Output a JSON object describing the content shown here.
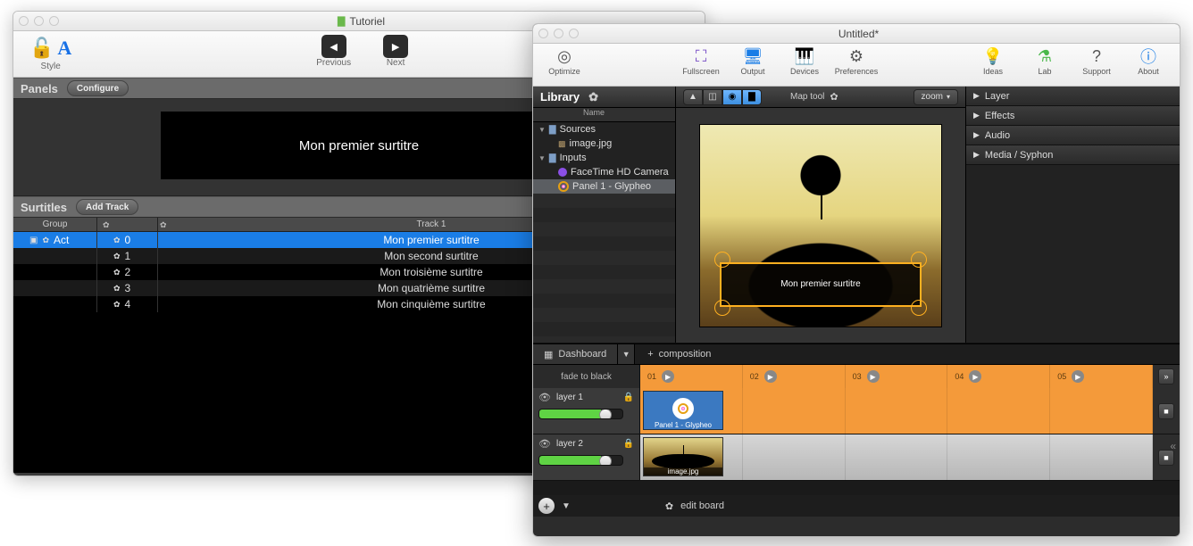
{
  "win1": {
    "title": "Tutoriel",
    "toolbar": {
      "style_label": "Style",
      "previous_label": "Previous",
      "next_label": "Next"
    },
    "panels": {
      "header": "Panels",
      "configure_btn": "Configure"
    },
    "preview_text": "Mon premier surtitre",
    "surtitles": {
      "header": "Surtitles",
      "add_track_btn": "Add Track",
      "col_group": "Group",
      "col_track": "Track 1"
    },
    "rows": [
      {
        "group": "Act",
        "num": "0",
        "text": "Mon premier surtitre",
        "selected": true,
        "has_group": true
      },
      {
        "group": "",
        "num": "1",
        "text": "Mon second surtitre",
        "selected": false,
        "has_group": false
      },
      {
        "group": "",
        "num": "2",
        "text": "Mon troisième surtitre",
        "selected": false,
        "has_group": false
      },
      {
        "group": "",
        "num": "3",
        "text": "Mon quatrième surtitre",
        "selected": false,
        "has_group": false
      },
      {
        "group": "",
        "num": "4",
        "text": "Mon cinquième surtitre",
        "selected": false,
        "has_group": false
      }
    ]
  },
  "win2": {
    "title": "Untitled*",
    "toolbar": [
      {
        "name": "optimize",
        "label": "Optimize",
        "glyph": "◎",
        "cls": ""
      },
      {
        "name": "fullscreen",
        "label": "Fullscreen",
        "glyph": "⛶",
        "cls": "c-purple"
      },
      {
        "name": "output",
        "label": "Output",
        "glyph": "🖥",
        "cls": "c-blue"
      },
      {
        "name": "devices",
        "label": "Devices",
        "glyph": "🎹",
        "cls": ""
      },
      {
        "name": "preferences",
        "label": "Preferences",
        "glyph": "⚙",
        "cls": ""
      },
      {
        "name": "ideas",
        "label": "Ideas",
        "glyph": "💡",
        "cls": "c-yellow"
      },
      {
        "name": "lab",
        "label": "Lab",
        "glyph": "⚗",
        "cls": "c-green"
      },
      {
        "name": "support",
        "label": "Support",
        "glyph": "?",
        "cls": ""
      },
      {
        "name": "about",
        "label": "About",
        "glyph": "ⓘ",
        "cls": "c-blue"
      }
    ],
    "library": {
      "header": "Library",
      "col_name": "Name",
      "tree": [
        {
          "kind": "folder",
          "label": "Sources",
          "depth": 0
        },
        {
          "kind": "image",
          "label": "image.jpg",
          "depth": 1
        },
        {
          "kind": "folder",
          "label": "Inputs",
          "depth": 0
        },
        {
          "kind": "camera",
          "label": "FaceTime HD Camera",
          "depth": 1
        },
        {
          "kind": "panel",
          "label": "Panel 1 - Glypheo",
          "depth": 1,
          "selected": true
        }
      ]
    },
    "stage": {
      "map_tool_label": "Map tool",
      "zoom_label": "zoom",
      "subtitle_text": "Mon premier surtitre"
    },
    "properties": [
      "Layer",
      "Effects",
      "Audio",
      "Media / Syphon"
    ],
    "tabs": {
      "dashboard": "Dashboard",
      "add": "composition"
    },
    "timeline": {
      "fade_label": "fade to black",
      "columns": [
        "01",
        "02",
        "03",
        "04",
        "05"
      ],
      "layers": [
        {
          "name": "layer 1",
          "thumb_caption": "Panel 1 - Glypheo"
        },
        {
          "name": "layer 2",
          "thumb_caption": "image.jpg"
        }
      ],
      "edit_board": "edit board"
    }
  }
}
